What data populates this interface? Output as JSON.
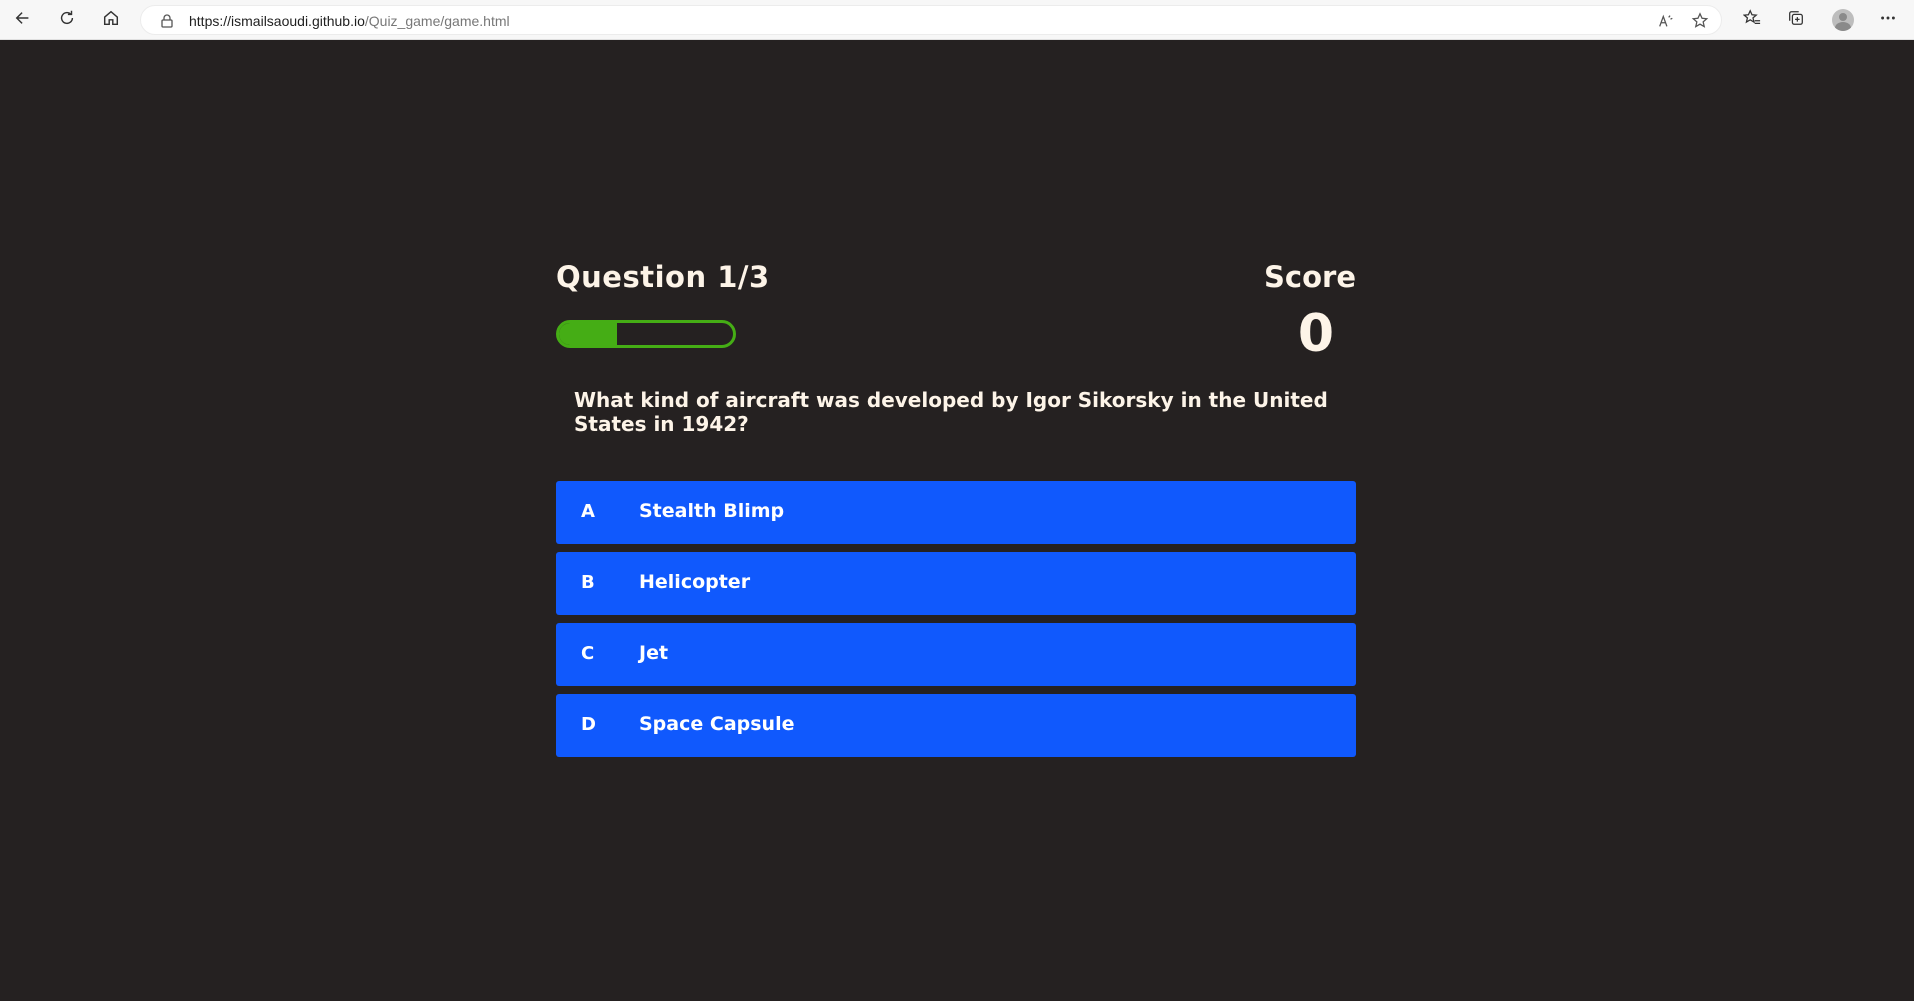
{
  "browser": {
    "url_host": "https://ismailsaoudi.github.io",
    "url_path": "/Quiz_game/game.html"
  },
  "hud": {
    "question_counter": "Question 1/3",
    "progress_fraction": 0.333,
    "score_label": "Score",
    "score_value": "0"
  },
  "question": {
    "text": "What kind of aircraft was developed by Igor Sikorsky in the United States in 1942?"
  },
  "choices": [
    {
      "prefix": "A",
      "text": "Stealth Blimp"
    },
    {
      "prefix": "B",
      "text": "Helicopter"
    },
    {
      "prefix": "C",
      "text": "Jet"
    },
    {
      "prefix": "D",
      "text": "Space Capsule"
    }
  ],
  "colors": {
    "background": "#252121",
    "accent_green": "#45ad15",
    "choice_blue": "#1059fd",
    "text_cream": "#fdf4e8"
  },
  "icons": {
    "back": "arrow-left-icon",
    "refresh": "refresh-icon",
    "home": "home-icon",
    "lock": "lock-icon",
    "read_aloud": "read-aloud-icon",
    "add_favorite": "star-add-icon",
    "favorites": "favorites-icon",
    "collections": "collections-icon",
    "profile": "avatar",
    "more": "more-icon"
  }
}
